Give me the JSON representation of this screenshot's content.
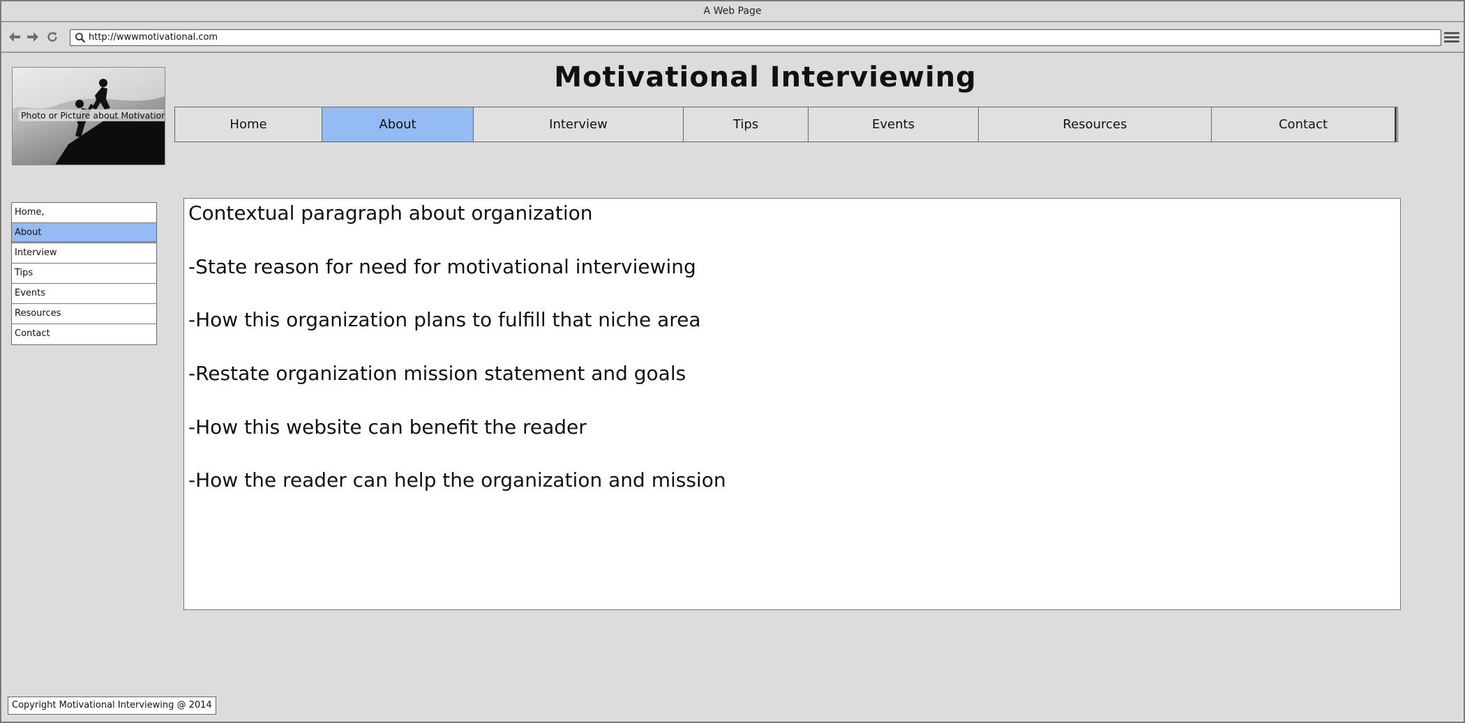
{
  "window": {
    "title": "A Web Page"
  },
  "browser": {
    "url": "http://wwwmotivational.com",
    "back_icon": "arrow-left-icon",
    "forward_icon": "arrow-right-icon",
    "reload_icon": "reload-icon",
    "menu_icon": "hamburger-menu-icon"
  },
  "header": {
    "logo_caption": "Photo or Picture about Motivation",
    "title": "Motivational Interviewing"
  },
  "top_nav": {
    "active_color": "#94bbf3",
    "items": [
      {
        "label": "Home"
      },
      {
        "label": "About",
        "active": true
      },
      {
        "label": "Interview"
      },
      {
        "label": "Tips"
      },
      {
        "label": "Events"
      },
      {
        "label": "Resources"
      },
      {
        "label": "Contact"
      }
    ]
  },
  "side_nav": {
    "items": [
      {
        "label": "Home,"
      },
      {
        "label": "About",
        "active": true
      },
      {
        "label": "Interview"
      },
      {
        "label": "Tips"
      },
      {
        "label": "Events"
      },
      {
        "label": "Resources"
      },
      {
        "label": "Contact"
      }
    ]
  },
  "content": {
    "lines": [
      "Contextual paragraph about organization",
      "-State reason for need for motivational interviewing",
      "-How this organization plans to fulfill that niche area",
      "-Restate organization mission statement and goals",
      "-How this website can benefit the reader",
      "-How the reader can help the organization and mission"
    ]
  },
  "footer": {
    "text": "Copyright Motivational Interviewing @ 2014"
  }
}
